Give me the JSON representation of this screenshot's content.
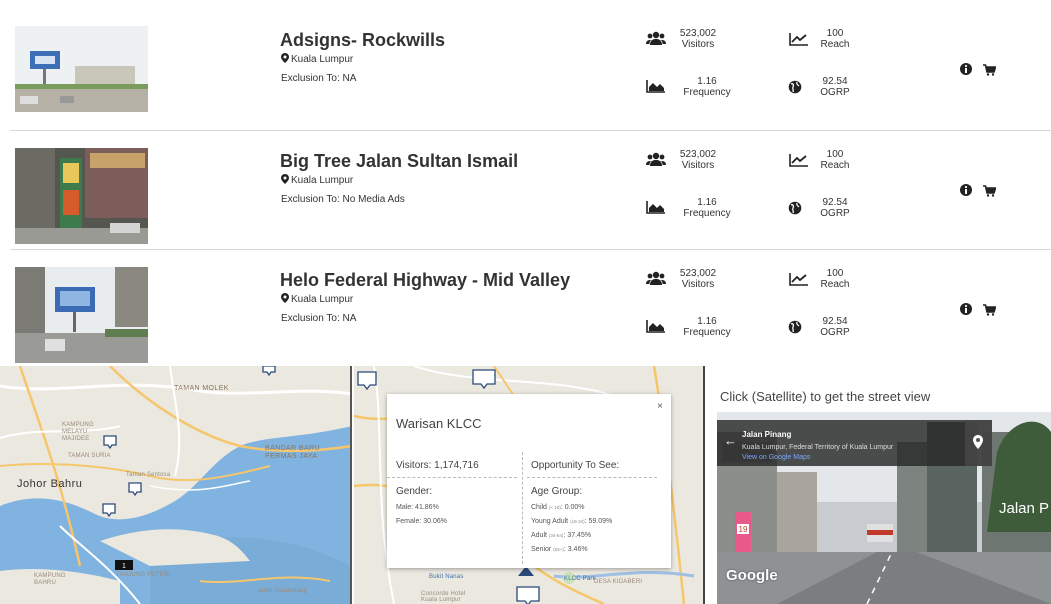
{
  "listings": [
    {
      "title": "Adsigns- Rockwills",
      "location": "Kuala Lumpur",
      "exclusion": "Exclusion To: NA",
      "visitors_value": "523,002",
      "visitors_label": "Visitors",
      "reach_value": "100",
      "reach_label": "Reach",
      "frequency_value": "1.16",
      "frequency_label": "Frequency",
      "ogrp_value": "92.54",
      "ogrp_label": "OGRP"
    },
    {
      "title": "Big Tree Jalan Sultan Ismail",
      "location": "Kuala Lumpur",
      "exclusion": "Exclusion To: No Media Ads",
      "visitors_value": "523,002",
      "visitors_label": "Visitors",
      "reach_value": "100",
      "reach_label": "Reach",
      "frequency_value": "1.16",
      "frequency_label": "Frequency",
      "ogrp_value": "92.54",
      "ogrp_label": "OGRP"
    },
    {
      "title": "Helo Federal Highway - Mid Valley",
      "location": "Kuala Lumpur",
      "exclusion": "Exclusion To: NA",
      "visitors_value": "523,002",
      "visitors_label": "Visitors",
      "reach_value": "100",
      "reach_label": "Reach",
      "frequency_value": "1.16",
      "frequency_label": "Frequency",
      "ogrp_value": "92.54",
      "ogrp_label": "OGRP"
    }
  ],
  "map1": {
    "labels": {
      "taman_molek": "TAMAN MOLEK",
      "kampung_melayu": "KAMPUNG MELAYU MAJIDEE",
      "taman_suria": "TAMAN SURIA",
      "bandar_baru": "BANDAR BARU PERMAS JAYA",
      "johor_bahru": "Johor Bahru",
      "taman_sentosa": "Taman Sentosa",
      "tanjung_puteri": "TANJUNG PUTERI",
      "kampung_bahru": "KAMPUNG BAHRU",
      "jalan_serampang": "Jalan Serampang",
      "cluster_count": "1"
    }
  },
  "popup": {
    "title": "Warisan KLCC",
    "close": "×",
    "visitors": "Visitors: 1,174,716",
    "opportunity": "Opportunity To See:",
    "gender_heading": "Gender:",
    "male": "Male: 41.86%",
    "female": "Female: 30.06%",
    "age_heading": "Age Group:",
    "age_groups": [
      {
        "label": "Child",
        "range": "(< 18)",
        "value": "0.00%"
      },
      {
        "label": "Young Adult",
        "range": "(18-34)",
        "value": "59.09%"
      },
      {
        "label": "Adult",
        "range": "(34-64)",
        "value": "37.45%"
      },
      {
        "label": "Senior",
        "range": "(65+)",
        "value": "3.46%"
      }
    ],
    "map_labels": {
      "bukit_nanas": "Bukit Nanas",
      "desa_kidaberi": "DESA KIDABERI",
      "concorde": "Concorde Hotel Kuala Lumpur",
      "klcc_park": "KLCC Park"
    }
  },
  "street_view": {
    "caption": "Click (Satellite) to get the street view",
    "place": "Jalan Pinang",
    "address": "Kuala Lumpur, Federal Territory of Kuala Lumpur",
    "google_maps": "View on Google Maps",
    "sign_text": "Jalan P",
    "logo": "Google"
  },
  "colors": {
    "map_land": "#eceae4",
    "water": "#7bb0de",
    "road_major": "#f6c86b",
    "road_minor": "#ffffff",
    "marker_fill": "#ffffff",
    "marker_stroke": "#2a4a7a"
  }
}
